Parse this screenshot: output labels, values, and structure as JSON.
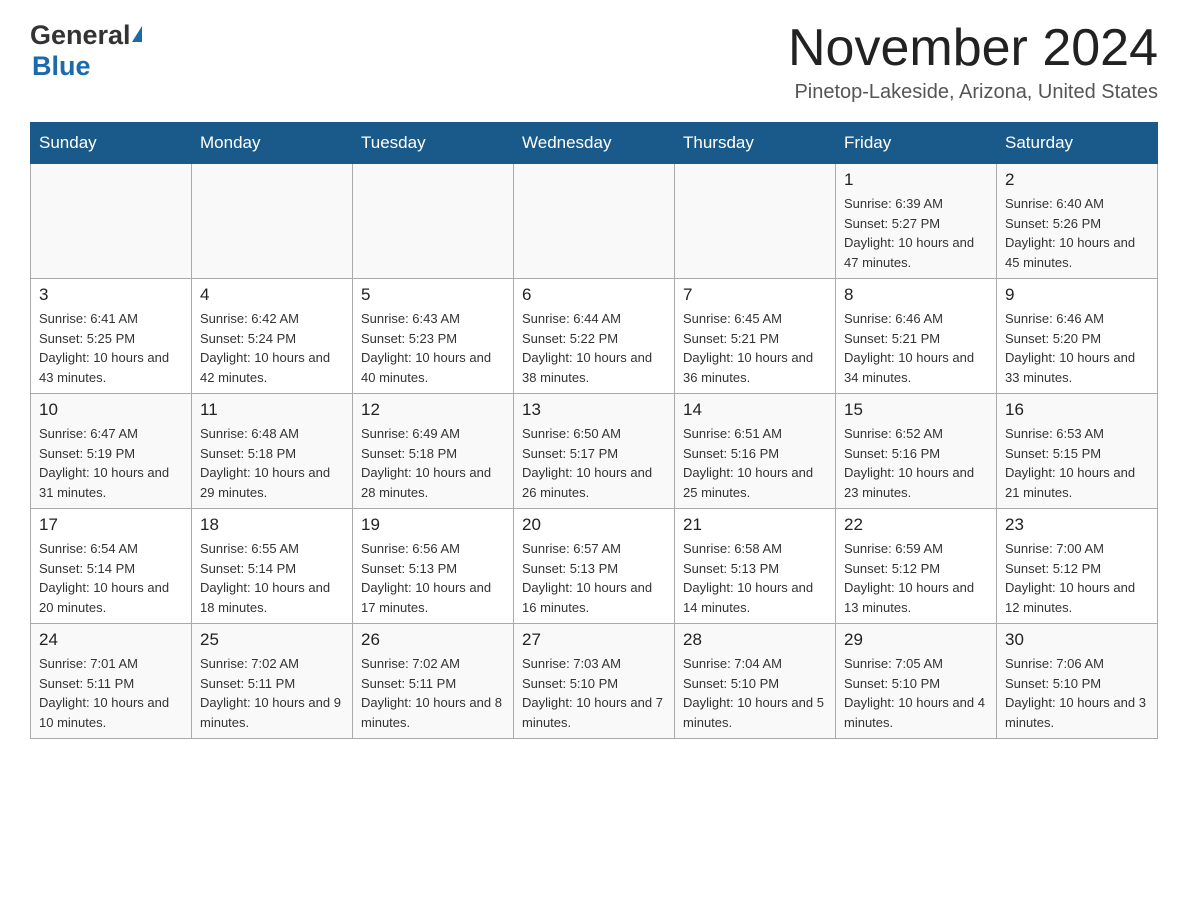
{
  "header": {
    "logo_general": "General",
    "logo_blue": "Blue",
    "month_title": "November 2024",
    "location": "Pinetop-Lakeside, Arizona, United States"
  },
  "calendar": {
    "days_of_week": [
      "Sunday",
      "Monday",
      "Tuesday",
      "Wednesday",
      "Thursday",
      "Friday",
      "Saturday"
    ],
    "weeks": [
      [
        {
          "day": "",
          "info": ""
        },
        {
          "day": "",
          "info": ""
        },
        {
          "day": "",
          "info": ""
        },
        {
          "day": "",
          "info": ""
        },
        {
          "day": "",
          "info": ""
        },
        {
          "day": "1",
          "info": "Sunrise: 6:39 AM\nSunset: 5:27 PM\nDaylight: 10 hours and 47 minutes."
        },
        {
          "day": "2",
          "info": "Sunrise: 6:40 AM\nSunset: 5:26 PM\nDaylight: 10 hours and 45 minutes."
        }
      ],
      [
        {
          "day": "3",
          "info": "Sunrise: 6:41 AM\nSunset: 5:25 PM\nDaylight: 10 hours and 43 minutes."
        },
        {
          "day": "4",
          "info": "Sunrise: 6:42 AM\nSunset: 5:24 PM\nDaylight: 10 hours and 42 minutes."
        },
        {
          "day": "5",
          "info": "Sunrise: 6:43 AM\nSunset: 5:23 PM\nDaylight: 10 hours and 40 minutes."
        },
        {
          "day": "6",
          "info": "Sunrise: 6:44 AM\nSunset: 5:22 PM\nDaylight: 10 hours and 38 minutes."
        },
        {
          "day": "7",
          "info": "Sunrise: 6:45 AM\nSunset: 5:21 PM\nDaylight: 10 hours and 36 minutes."
        },
        {
          "day": "8",
          "info": "Sunrise: 6:46 AM\nSunset: 5:21 PM\nDaylight: 10 hours and 34 minutes."
        },
        {
          "day": "9",
          "info": "Sunrise: 6:46 AM\nSunset: 5:20 PM\nDaylight: 10 hours and 33 minutes."
        }
      ],
      [
        {
          "day": "10",
          "info": "Sunrise: 6:47 AM\nSunset: 5:19 PM\nDaylight: 10 hours and 31 minutes."
        },
        {
          "day": "11",
          "info": "Sunrise: 6:48 AM\nSunset: 5:18 PM\nDaylight: 10 hours and 29 minutes."
        },
        {
          "day": "12",
          "info": "Sunrise: 6:49 AM\nSunset: 5:18 PM\nDaylight: 10 hours and 28 minutes."
        },
        {
          "day": "13",
          "info": "Sunrise: 6:50 AM\nSunset: 5:17 PM\nDaylight: 10 hours and 26 minutes."
        },
        {
          "day": "14",
          "info": "Sunrise: 6:51 AM\nSunset: 5:16 PM\nDaylight: 10 hours and 25 minutes."
        },
        {
          "day": "15",
          "info": "Sunrise: 6:52 AM\nSunset: 5:16 PM\nDaylight: 10 hours and 23 minutes."
        },
        {
          "day": "16",
          "info": "Sunrise: 6:53 AM\nSunset: 5:15 PM\nDaylight: 10 hours and 21 minutes."
        }
      ],
      [
        {
          "day": "17",
          "info": "Sunrise: 6:54 AM\nSunset: 5:14 PM\nDaylight: 10 hours and 20 minutes."
        },
        {
          "day": "18",
          "info": "Sunrise: 6:55 AM\nSunset: 5:14 PM\nDaylight: 10 hours and 18 minutes."
        },
        {
          "day": "19",
          "info": "Sunrise: 6:56 AM\nSunset: 5:13 PM\nDaylight: 10 hours and 17 minutes."
        },
        {
          "day": "20",
          "info": "Sunrise: 6:57 AM\nSunset: 5:13 PM\nDaylight: 10 hours and 16 minutes."
        },
        {
          "day": "21",
          "info": "Sunrise: 6:58 AM\nSunset: 5:13 PM\nDaylight: 10 hours and 14 minutes."
        },
        {
          "day": "22",
          "info": "Sunrise: 6:59 AM\nSunset: 5:12 PM\nDaylight: 10 hours and 13 minutes."
        },
        {
          "day": "23",
          "info": "Sunrise: 7:00 AM\nSunset: 5:12 PM\nDaylight: 10 hours and 12 minutes."
        }
      ],
      [
        {
          "day": "24",
          "info": "Sunrise: 7:01 AM\nSunset: 5:11 PM\nDaylight: 10 hours and 10 minutes."
        },
        {
          "day": "25",
          "info": "Sunrise: 7:02 AM\nSunset: 5:11 PM\nDaylight: 10 hours and 9 minutes."
        },
        {
          "day": "26",
          "info": "Sunrise: 7:02 AM\nSunset: 5:11 PM\nDaylight: 10 hours and 8 minutes."
        },
        {
          "day": "27",
          "info": "Sunrise: 7:03 AM\nSunset: 5:10 PM\nDaylight: 10 hours and 7 minutes."
        },
        {
          "day": "28",
          "info": "Sunrise: 7:04 AM\nSunset: 5:10 PM\nDaylight: 10 hours and 5 minutes."
        },
        {
          "day": "29",
          "info": "Sunrise: 7:05 AM\nSunset: 5:10 PM\nDaylight: 10 hours and 4 minutes."
        },
        {
          "day": "30",
          "info": "Sunrise: 7:06 AM\nSunset: 5:10 PM\nDaylight: 10 hours and 3 minutes."
        }
      ]
    ]
  }
}
